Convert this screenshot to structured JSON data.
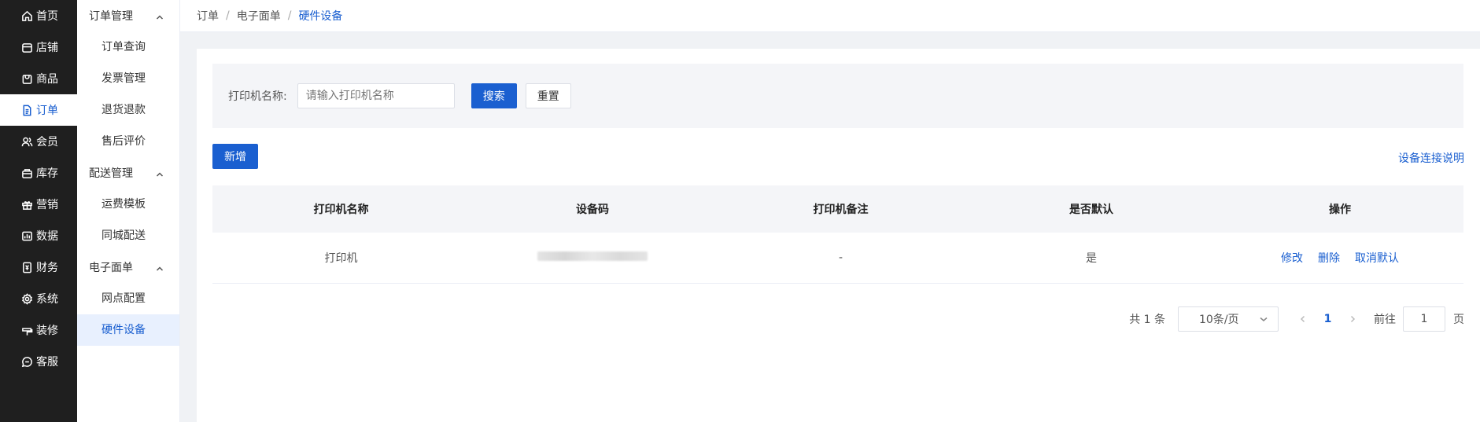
{
  "nav": {
    "items": [
      {
        "label": "首页",
        "icon": "home-icon"
      },
      {
        "label": "店铺",
        "icon": "store-icon"
      },
      {
        "label": "商品",
        "icon": "goods-icon"
      },
      {
        "label": "订单",
        "icon": "order-icon"
      },
      {
        "label": "会员",
        "icon": "member-icon"
      },
      {
        "label": "库存",
        "icon": "inventory-icon"
      },
      {
        "label": "营销",
        "icon": "gift-icon"
      },
      {
        "label": "数据",
        "icon": "chart-icon"
      },
      {
        "label": "财务",
        "icon": "finance-icon"
      },
      {
        "label": "系统",
        "icon": "gear-icon"
      },
      {
        "label": "装修",
        "icon": "decorate-icon"
      },
      {
        "label": "客服",
        "icon": "chat-icon"
      }
    ],
    "active_index": 3
  },
  "subnav": {
    "groups": [
      {
        "label": "订单管理",
        "items": [
          "订单查询",
          "发票管理",
          "退货退款",
          "售后评价"
        ]
      },
      {
        "label": "配送管理",
        "items": [
          "运费模板",
          "同城配送"
        ]
      },
      {
        "label": "电子面单",
        "items": [
          "网点配置",
          "硬件设备"
        ]
      }
    ],
    "active_item": "硬件设备"
  },
  "breadcrumb": [
    "订单",
    "电子面单",
    "硬件设备"
  ],
  "breadcrumb_sep": "/",
  "filter": {
    "label": "打印机名称:",
    "placeholder": "请输入打印机名称",
    "search_label": "搜索",
    "reset_label": "重置"
  },
  "toolbar": {
    "add_label": "新增",
    "help_link": "设备连接说明"
  },
  "table": {
    "columns": [
      "打印机名称",
      "设备码",
      "打印机备注",
      "是否默认",
      "操作"
    ],
    "rows": [
      {
        "name": "打印机",
        "code": "",
        "remark": "-",
        "is_default": "是",
        "actions": [
          "修改",
          "删除",
          "取消默认"
        ]
      }
    ]
  },
  "pagination": {
    "total_text": "共 1 条",
    "page_size": "10条/页",
    "current_page": "1",
    "goto_label": "前往",
    "goto_value": "1",
    "goto_suffix": "页"
  },
  "colors": {
    "accent": "#1a5fd0",
    "sidebar_bg": "#1f1f1f"
  }
}
